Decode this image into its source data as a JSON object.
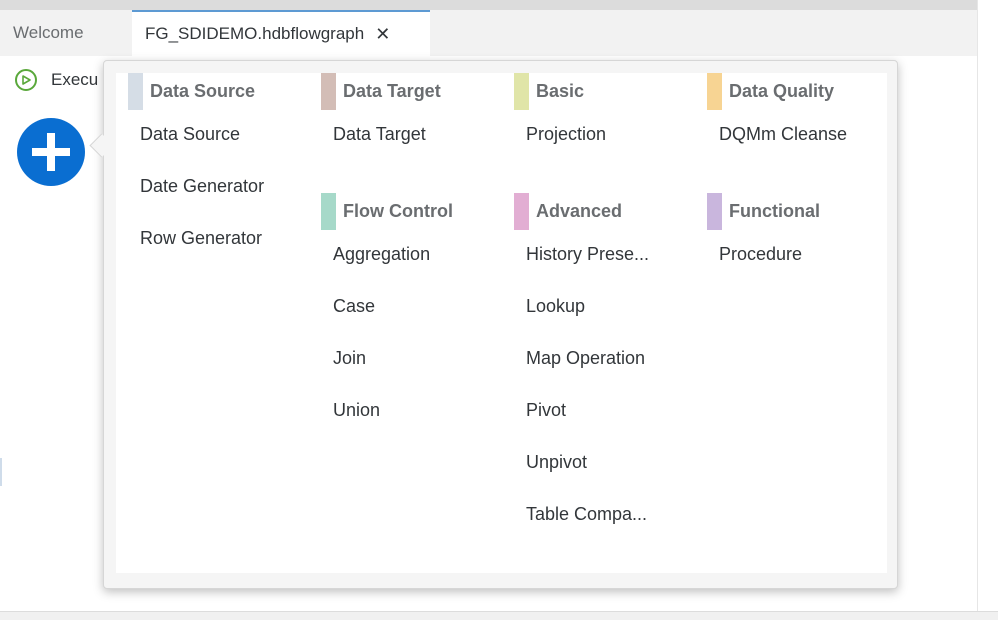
{
  "tabs": [
    {
      "label": "Welcome",
      "active": false
    },
    {
      "label": "FG_SDIDEMO.hdbflowgraph",
      "active": true
    }
  ],
  "tab_close_glyph": "✕",
  "toolbar": {
    "execute_label": "Execu"
  },
  "palette": {
    "groups": [
      {
        "title": "Data Source",
        "color": "#d5dde6",
        "items": [
          "Data Source",
          "Date Generator",
          "Row Generator"
        ]
      },
      {
        "title": "Data Target",
        "color": "#d3bdb6",
        "items": [
          "Data Target"
        ]
      },
      {
        "title": "Flow Control",
        "color": "#a6d9c9",
        "items": [
          "Aggregation",
          "Case",
          "Join",
          "Union"
        ]
      },
      {
        "title": "Basic",
        "color": "#e0e5a8",
        "items": [
          "Projection"
        ]
      },
      {
        "title": "Advanced",
        "color": "#e2aed3",
        "items": [
          "History Prese...",
          "Lookup",
          "Map Operation",
          "Pivot",
          "Unpivot",
          "Table Compa..."
        ]
      },
      {
        "title": "Data Quality",
        "color": "#f7d493",
        "items": [
          "DQMm Cleanse"
        ]
      },
      {
        "title": "Functional",
        "color": "#c9b6dd",
        "items": [
          "Procedure"
        ]
      }
    ]
  },
  "colors": {
    "accent": "#0a6ed1",
    "execute": "#5aa83b",
    "active_tab_border": "#5d9ad3"
  }
}
